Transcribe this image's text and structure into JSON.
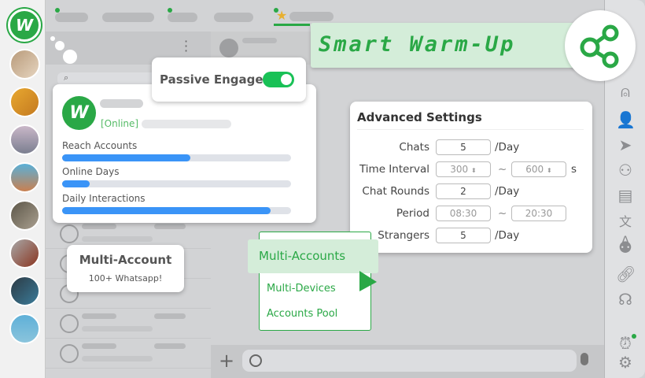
{
  "brand": {
    "logo_letter": "W",
    "accent": "#2aa846"
  },
  "banner": {
    "title": "Smart Warm-Up",
    "icon": "share-icon"
  },
  "passive": {
    "label": "Passive Engage",
    "enabled": true
  },
  "account_card": {
    "status": "[Online]",
    "metrics": [
      {
        "label": "Reach Accounts",
        "progress": 0.56
      },
      {
        "label": "Online Days",
        "progress": 0.12
      },
      {
        "label": "Daily Interactions",
        "progress": 0.91
      }
    ]
  },
  "multi_account": {
    "title": "Multi-Account",
    "subtitle": "100+ Whatsapp!"
  },
  "menu": {
    "items": [
      {
        "label": "Multi-Accounts",
        "active": true
      },
      {
        "label": "Multi-Devices"
      },
      {
        "label": "Accounts Pool"
      }
    ]
  },
  "advanced": {
    "title": "Advanced Settings",
    "rows": [
      {
        "label": "Chats",
        "value": "5",
        "unit": "/Day"
      },
      {
        "label": "Time Interval",
        "from": "300",
        "to": "600",
        "unit": "s"
      },
      {
        "label": "Chat Rounds",
        "value": "2",
        "unit": "/Day"
      },
      {
        "label": "Period",
        "from": "08:30",
        "to": "20:30"
      },
      {
        "label": "Strangers",
        "value": "5",
        "unit": "/Day"
      }
    ],
    "tilde": "~"
  },
  "right_sidebar": [
    "person-pin-icon",
    "contact-search-icon",
    "send-icon",
    "contacts-icon",
    "message-icon",
    "translate-icon",
    "group-icon",
    "link-icon",
    "support-icon",
    "alarm-icon",
    "settings-icon"
  ]
}
